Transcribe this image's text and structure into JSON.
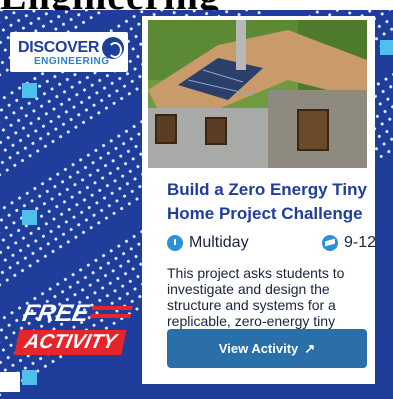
{
  "banner": {
    "text": "Engineering"
  },
  "logo": {
    "line1": "DISCOVER",
    "line2": "ENGINEERING"
  },
  "promo": {
    "line1": "FREE",
    "line2": "ACTIVITY"
  },
  "card": {
    "title": "Build a Zero Energy Tiny Home Project Challenge",
    "duration": "Multiday",
    "grades": "9-12",
    "description": "This project asks students to investigate and design the structure and systems for a replicable, zero-energy tiny home.",
    "button_label": "View Activity",
    "button_icon": "arrow-up-right-icon"
  },
  "colors": {
    "navy": "#1f3e9c",
    "accent": "#4fc0ec",
    "button": "#2a6fa8",
    "red": "#e8242b"
  }
}
